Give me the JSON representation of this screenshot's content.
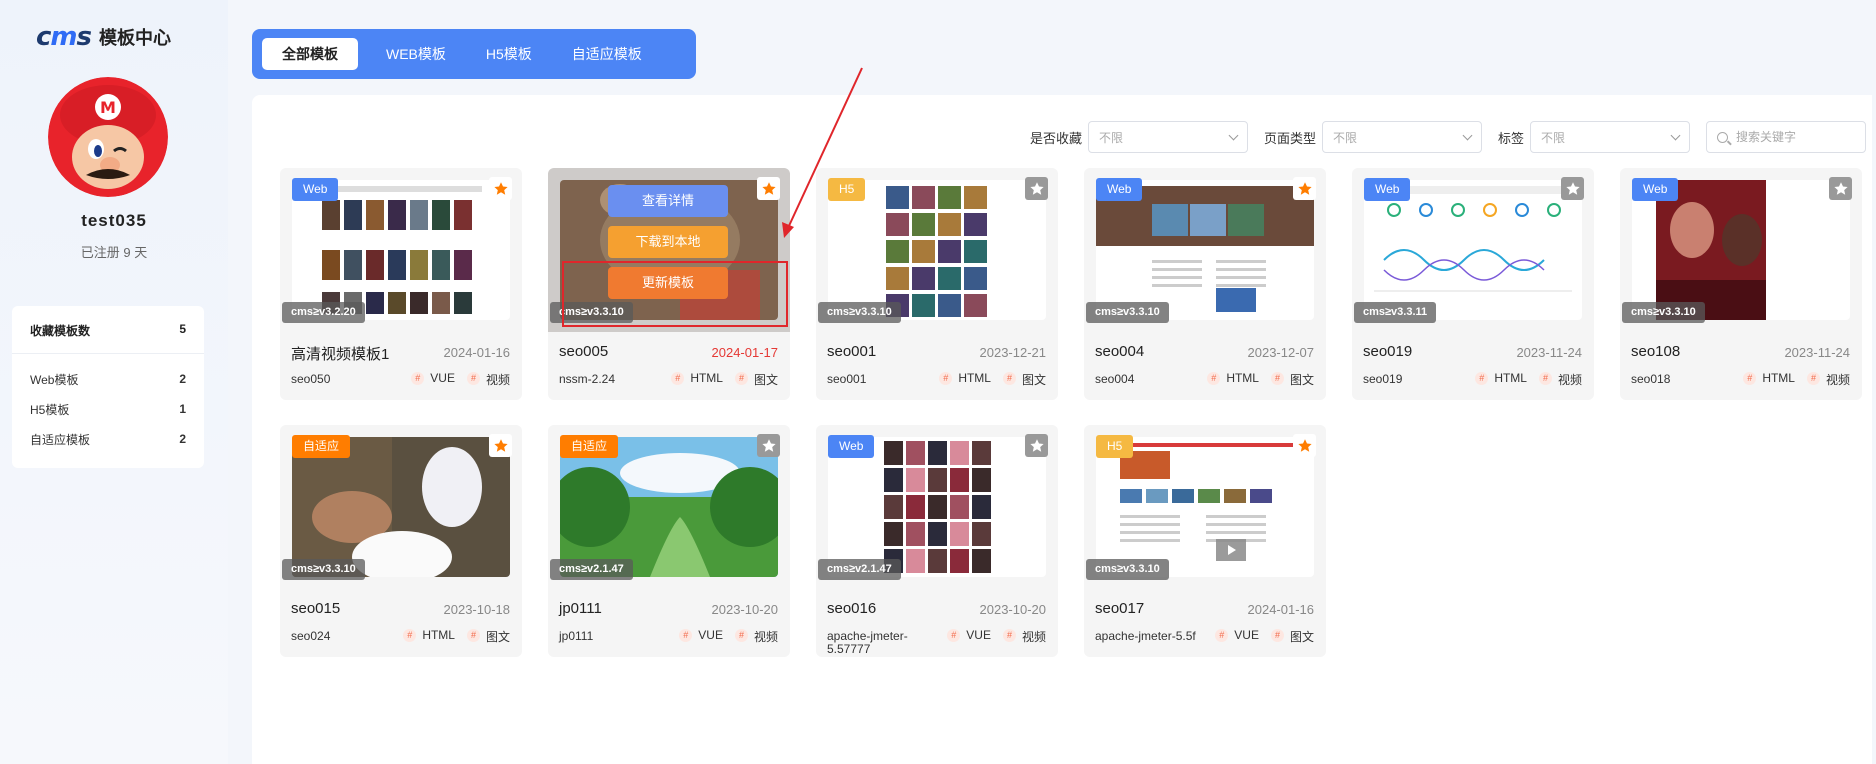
{
  "sidebar": {
    "logo_mark_left": "c",
    "logo_mark_mid": "m",
    "logo_mark_right": "s",
    "logo_text": "模板中心",
    "username": "test035",
    "registered": "已注册 9 天",
    "stats": {
      "header_label": "收藏模板数",
      "header_count": "5",
      "items": [
        {
          "label": "Web模板",
          "count": "2"
        },
        {
          "label": "H5模板",
          "count": "1"
        },
        {
          "label": "自适应模板",
          "count": "2"
        }
      ]
    }
  },
  "tabs": [
    {
      "label": "全部模板",
      "active": true
    },
    {
      "label": "WEB模板"
    },
    {
      "label": "H5模板"
    },
    {
      "label": "自适应模板"
    }
  ],
  "filters": {
    "fav_label": "是否收藏",
    "fav_value": "不限",
    "type_label": "页面类型",
    "type_value": "不限",
    "tag_label": "标签",
    "tag_value": "不限",
    "search_placeholder": "搜索关键字"
  },
  "hover_buttons": {
    "detail": "查看详情",
    "download": "下载到本地",
    "update": "更新模板"
  },
  "colors": {
    "accent": "#4c85f5",
    "web_badge": "#4c85f5",
    "h5_badge": "#f5b942",
    "adaptive_badge": "#ff7d00",
    "star_active": "#ff7d00",
    "star_inactive": "#999999"
  },
  "cards": [
    {
      "badge": "Web",
      "badge_type": "web",
      "starred": true,
      "version": "cms≥v3.2.20",
      "title": "高清视频模板1",
      "date": "2024-01-16",
      "sub": "seo050",
      "tags": [
        "VUE",
        "视频"
      ]
    },
    {
      "badge": "",
      "badge_type": "none",
      "starred": true,
      "version": "cms≥v3.3.10",
      "title": "seo005",
      "date": "2024-01-17",
      "date_red": true,
      "sub": "nssm-2.24",
      "tags": [
        "HTML",
        "图文"
      ]
    },
    {
      "badge": "H5",
      "badge_type": "h5",
      "starred": false,
      "version": "cms≥v3.3.10",
      "title": "seo001",
      "date": "2023-12-21",
      "sub": "seo001",
      "tags": [
        "HTML",
        "图文"
      ]
    },
    {
      "badge": "Web",
      "badge_type": "web",
      "starred": true,
      "version": "cms≥v3.3.10",
      "title": "seo004",
      "date": "2023-12-07",
      "sub": "seo004",
      "tags": [
        "HTML",
        "图文"
      ]
    },
    {
      "badge": "Web",
      "badge_type": "web",
      "starred": false,
      "version": "cms≥v3.3.11",
      "title": "seo019",
      "date": "2023-11-24",
      "sub": "seo019",
      "tags": [
        "HTML",
        "视频"
      ]
    },
    {
      "badge": "Web",
      "badge_type": "web",
      "starred": false,
      "version": "cms≥v3.3.10",
      "title": "seo108",
      "date": "2023-11-24",
      "sub": "seo018",
      "tags": [
        "HTML",
        "视频"
      ]
    },
    {
      "badge": "自适应",
      "badge_type": "adaptive",
      "starred": true,
      "version": "cms≥v3.3.10",
      "title": "seo015",
      "date": "2023-10-18",
      "sub": "seo024",
      "tags": [
        "HTML",
        "图文"
      ]
    },
    {
      "badge": "自适应",
      "badge_type": "adaptive",
      "starred": false,
      "version": "cms≥v2.1.47",
      "title": "jp0111",
      "date": "2023-10-20",
      "sub": "jp0111",
      "tags": [
        "VUE",
        "视频"
      ]
    },
    {
      "badge": "Web",
      "badge_type": "web",
      "starred": false,
      "version": "cms≥v2.1.47",
      "title": "seo016",
      "date": "2023-10-20",
      "sub": "apache-jmeter-5.57777",
      "tags": [
        "VUE",
        "视频"
      ]
    },
    {
      "badge": "H5",
      "badge_type": "h5",
      "starred": true,
      "version": "cms≥v3.3.10",
      "title": "seo017",
      "date": "2024-01-16",
      "sub": "apache-jmeter-5.5f",
      "tags": [
        "VUE",
        "图文"
      ]
    }
  ]
}
